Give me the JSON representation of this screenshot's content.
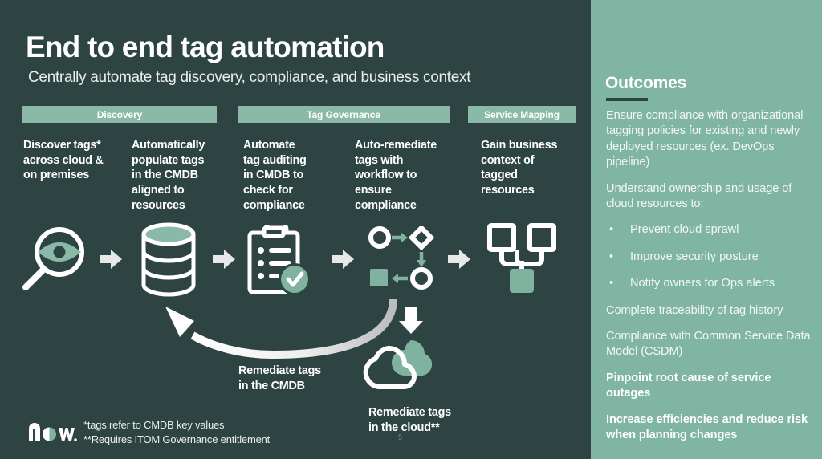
{
  "slide": {
    "title": "End to end tag automation",
    "subtitle": "Centrally automate tag discovery, compliance, and business context",
    "page_number": "5",
    "colors": {
      "background": "#2e4442",
      "panel_green": "#80b5a3",
      "banner_green": "#8bb9a8",
      "accent_green": "#7fb39f",
      "text_white": "#ffffff",
      "arrow_gray": "#e6e9e8"
    }
  },
  "phases": [
    {
      "label": "Discovery"
    },
    {
      "label": "Tag Governance"
    },
    {
      "label": "Service Mapping"
    }
  ],
  "steps": [
    {
      "lines": [
        "Discover tags*",
        "across cloud &",
        "on premises"
      ],
      "icon": "magnifier-eye-icon"
    },
    {
      "lines": [
        "Automatically",
        "populate tags",
        "in the CMDB",
        "aligned to",
        "resources"
      ],
      "icon": "database-icon"
    },
    {
      "lines": [
        "Automate",
        "tag auditing",
        "in CMDB to",
        "check for",
        "compliance"
      ],
      "icon": "clipboard-check-icon"
    },
    {
      "lines": [
        "Auto-remediate",
        "tags with",
        "workflow to",
        "ensure",
        "compliance"
      ],
      "icon": "workflow-icon"
    },
    {
      "lines": [
        "Gain business",
        "context of",
        "tagged",
        "resources"
      ],
      "icon": "service-map-icon"
    }
  ],
  "callouts": {
    "cmdb": {
      "lines": [
        "Remediate tags",
        "in the CMDB"
      ],
      "icon": "curved-loop-arrow-icon"
    },
    "cloud": {
      "lines": [
        "Remediate tags",
        "in the cloud**"
      ],
      "icon": "cloud-icon"
    }
  },
  "footnotes": {
    "line1": "*tags refer to CMDB key values",
    "line2": "**Requires ITOM Governance entitlement"
  },
  "logo": {
    "text": "now.",
    "name": "servicenow-logo"
  },
  "outcomes": {
    "title": "Outcomes",
    "items": [
      {
        "type": "para",
        "bold": false,
        "text": "Ensure compliance with organizational tagging policies for existing and newly deployed resources (ex. DevOps pipeline)"
      },
      {
        "type": "para",
        "bold": false,
        "text": "Understand ownership and usage of cloud resources to:"
      },
      {
        "type": "bullet",
        "bold": false,
        "text": "Prevent cloud sprawl"
      },
      {
        "type": "bullet",
        "bold": false,
        "text": "Improve security posture"
      },
      {
        "type": "bullet",
        "bold": false,
        "text": "Notify owners for Ops alerts"
      },
      {
        "type": "para",
        "bold": false,
        "text": "Complete traceability of tag history"
      },
      {
        "type": "para",
        "bold": false,
        "text": "Compliance with Common Service Data Model (CSDM)"
      },
      {
        "type": "para",
        "bold": true,
        "text": "Pinpoint root cause of service outages"
      },
      {
        "type": "para",
        "bold": true,
        "text": "Increase efficiencies and reduce risk when planning changes"
      }
    ],
    "bullet_glyph": "•"
  }
}
